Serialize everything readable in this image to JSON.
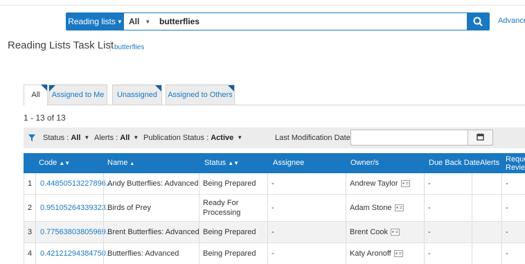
{
  "search": {
    "scope_label": "Reading lists",
    "all_label": "All",
    "query": "butterflies",
    "advanced_label": "Advanced"
  },
  "header": {
    "title": "Reading Lists Task List",
    "subtitle": "butterflies"
  },
  "tabs": [
    {
      "label": "All",
      "active": true
    },
    {
      "label": "Assigned to Me",
      "active": false
    },
    {
      "label": "Unassigned",
      "active": false
    },
    {
      "label": "Assigned to Others",
      "active": false
    }
  ],
  "results_count": "1 - 13 of 13",
  "filters": {
    "status_label": "Status :",
    "status_value": "All",
    "alerts_label": "Alerts :",
    "alerts_value": "All",
    "pub_status_label": "Publication Status :",
    "pub_status_value": "Active",
    "last_mod_label": "Last Modification Date",
    "last_mod_value": ""
  },
  "table": {
    "columns": [
      "Code",
      "Name",
      "Status",
      "Assignee",
      "Owner/s",
      "Due Back Date",
      "Alerts",
      "Reque",
      "Review"
    ],
    "rows": [
      {
        "num": "1",
        "code": "0.44850513227896...",
        "name": "Andy Butterflies: Advanced",
        "status": [
          "Being Prepared"
        ],
        "assignee": "-",
        "owner": "Andrew Taylor",
        "due": "-",
        "alerts": "",
        "request": "-"
      },
      {
        "num": "2",
        "code": "0.95105264339323...",
        "name": "Birds of Prey",
        "status": [
          "Ready For",
          "Processing"
        ],
        "assignee": "-",
        "owner": "Adam Stone",
        "due": "-",
        "alerts": "",
        "request": "-"
      },
      {
        "num": "3",
        "code": "0.77563803805969...",
        "name": "Brent Butterflies: Advanced",
        "status": [
          "Being Prepared"
        ],
        "assignee": "-",
        "owner": "Brent Cook",
        "due": "-",
        "alerts": "",
        "request": "-"
      },
      {
        "num": "4",
        "code": "0.42121294384750...",
        "name": "Butterflies: Advanced",
        "status": [
          "Being Prepared"
        ],
        "assignee": "-",
        "owner": "Katy Aronoff",
        "due": "-",
        "alerts": "",
        "request": "-"
      }
    ]
  },
  "colors": {
    "accent": "#1a78c2",
    "tab_corner": "#1a5f9e"
  },
  "icons": [
    "search-icon",
    "filter-icon",
    "calendar-icon",
    "contact-card-icon",
    "sort-icon",
    "caret-down-icon"
  ]
}
